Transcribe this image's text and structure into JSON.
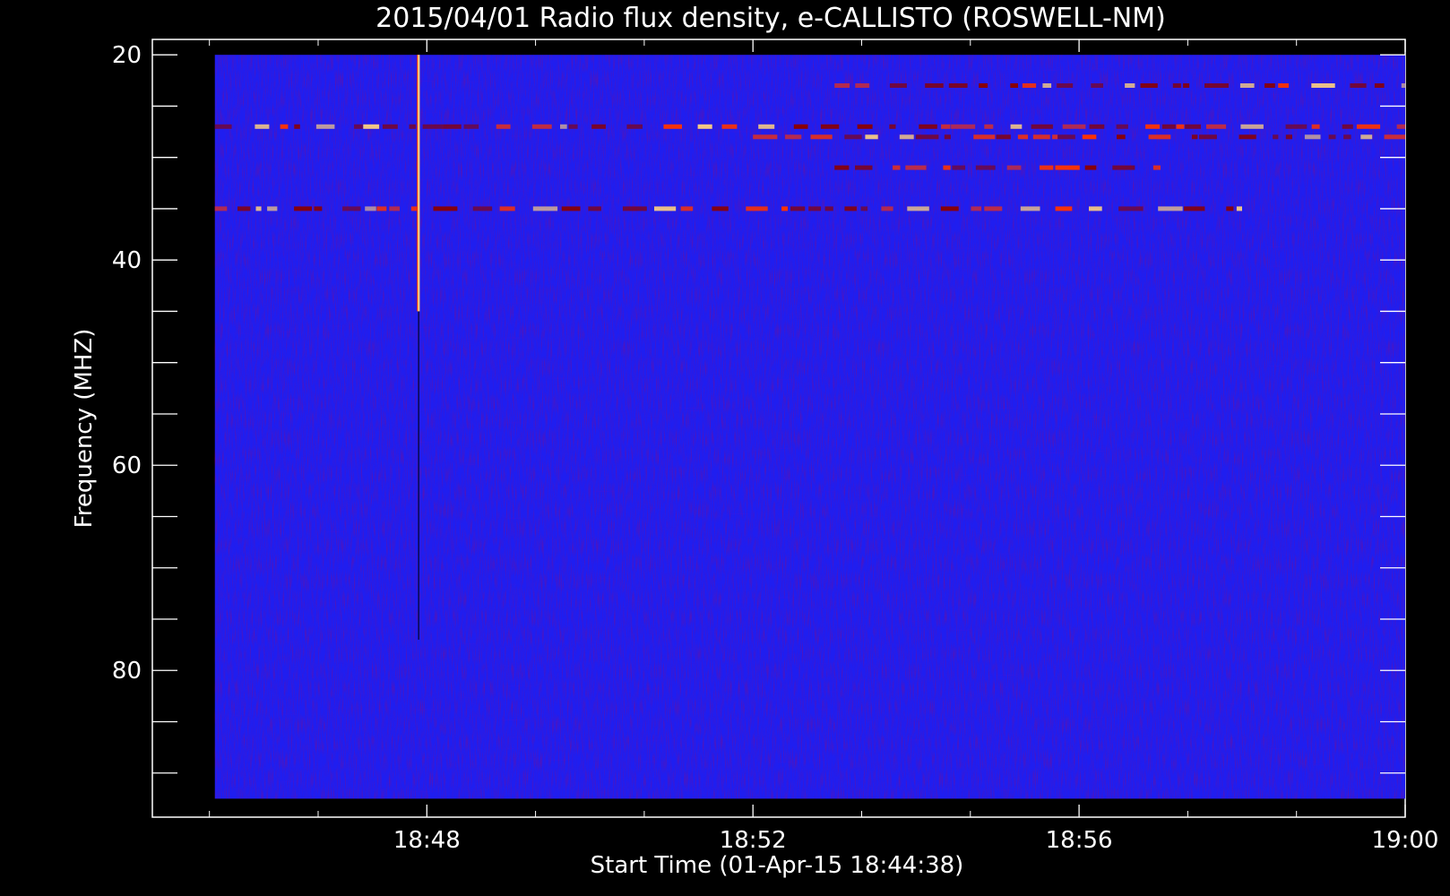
{
  "chart_data": {
    "type": "heatmap",
    "title": "2015/04/01  Radio flux density, e-CALLISTO (ROSWELL-NM)",
    "xlabel": "Start Time (01-Apr-15 18:44:38)",
    "ylabel": "Frequency (MHZ)",
    "x_range": [
      "18:44:38",
      "19:00:00"
    ],
    "y_range_mhz": [
      18.5,
      94.3
    ],
    "y_inverted": true,
    "x_ticks": [
      "18:48",
      "18:52",
      "18:56",
      "19:00"
    ],
    "y_ticks": [
      20,
      40,
      60,
      80
    ],
    "data_extent_mhz": [
      20,
      92.5
    ],
    "data_extent_time": [
      "18:45:24",
      "19:00:00"
    ],
    "colormap": [
      "#0000ff",
      "#8b0000",
      "#ff3300",
      "#ffd27f"
    ],
    "features": [
      {
        "kind": "vertical_burst",
        "time": "18:47:54",
        "freq_range_mhz": [
          20,
          77
        ]
      },
      {
        "kind": "horizontal_band",
        "freq_mhz": 23,
        "time_range": [
          "18:53:00",
          "19:00:00"
        ]
      },
      {
        "kind": "horizontal_band",
        "freq_mhz": 27,
        "time_range": [
          "18:45:24",
          "19:00:00"
        ]
      },
      {
        "kind": "horizontal_band",
        "freq_mhz": 28,
        "time_range": [
          "18:52:00",
          "19:00:00"
        ]
      },
      {
        "kind": "horizontal_band",
        "freq_mhz": 31,
        "time_range": [
          "18:53:00",
          "18:57:00"
        ]
      },
      {
        "kind": "horizontal_band",
        "freq_mhz": 35,
        "time_range": [
          "18:45:24",
          "18:58:00"
        ]
      }
    ]
  }
}
